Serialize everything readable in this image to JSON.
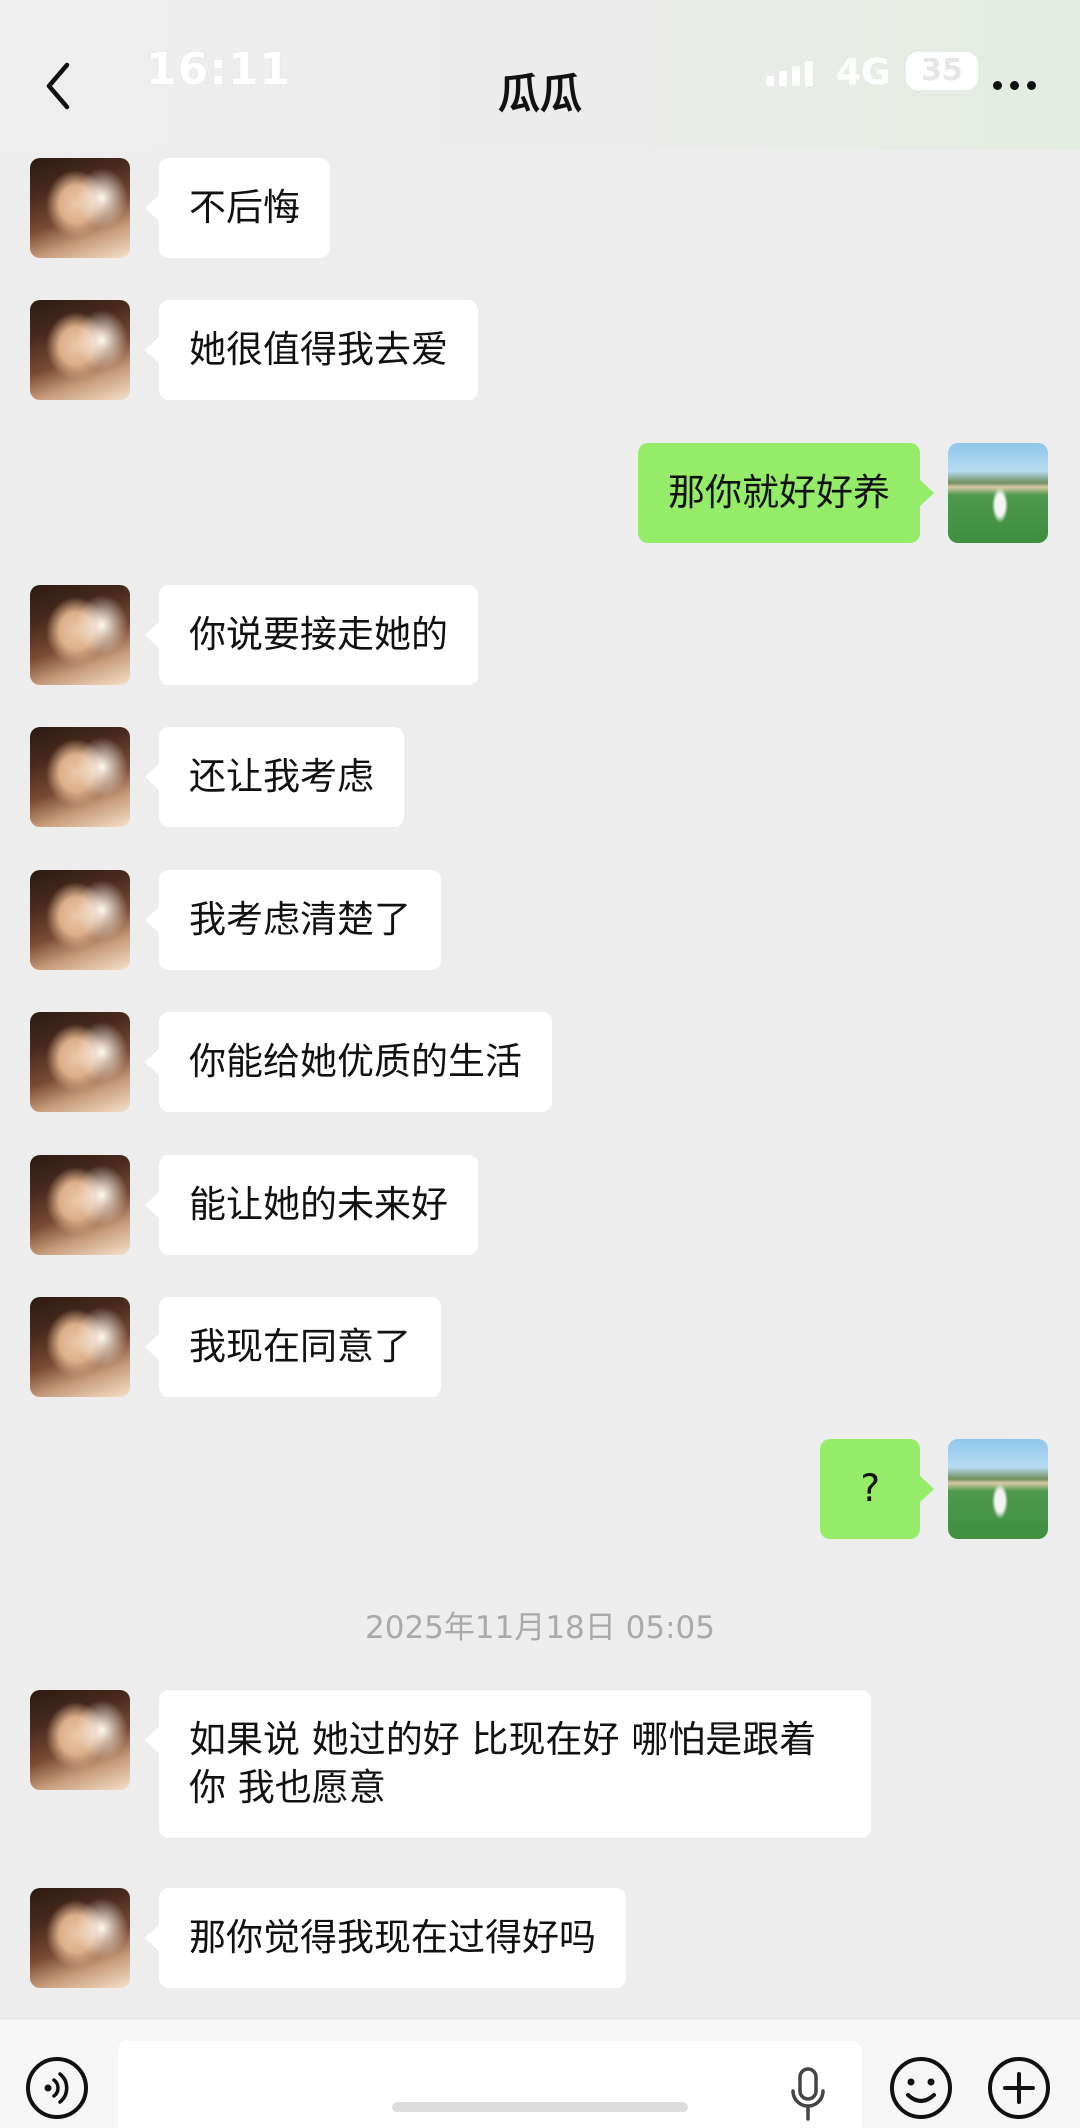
{
  "status_bar": {
    "time": "16:11",
    "network": "4G",
    "battery": "35"
  },
  "header": {
    "title": "瓜瓜",
    "back_icon": "chevron-left-icon",
    "more_icon": "more-dots-icon"
  },
  "messages": [
    {
      "side": "left",
      "text": "不后悔"
    },
    {
      "side": "left",
      "text": "她很值得我去爱"
    },
    {
      "side": "right",
      "text": "那你就好好养"
    },
    {
      "side": "left",
      "text": "你说要接走她的"
    },
    {
      "side": "left",
      "text": "还让我考虑"
    },
    {
      "side": "left",
      "text": "我考虑清楚了"
    },
    {
      "side": "left",
      "text": "你能给她优质的生活"
    },
    {
      "side": "left",
      "text": "能让她的未来好"
    },
    {
      "side": "left",
      "text": "我现在同意了"
    },
    {
      "side": "right",
      "text": "?"
    },
    {
      "side": "left",
      "text": "如果说 她过的好 比现在好 哪怕是跟着你 我也愿意"
    },
    {
      "side": "left",
      "text": "那你觉得我现在过得好吗"
    }
  ],
  "timestamp": "2025年11月18日 05:05",
  "input_bar": {
    "voice_icon": "voice-mode-icon",
    "mic_icon": "microphone-icon",
    "emoji_icon": "emoji-icon",
    "plus_icon": "plus-icon",
    "input_value": ""
  },
  "colors": {
    "background": "#ededed",
    "incoming_bubble": "#ffffff",
    "outgoing_bubble": "#95ec69",
    "timestamp_text": "#a9a9a9"
  }
}
